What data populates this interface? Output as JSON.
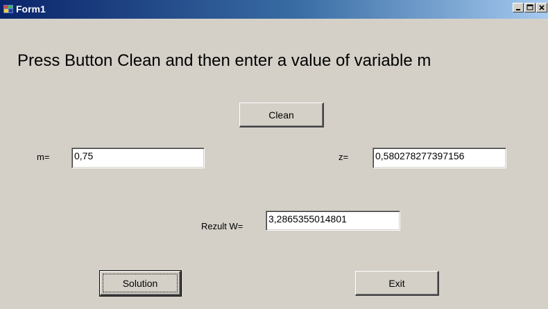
{
  "window": {
    "title": "Form1",
    "controls": [
      "minimize-icon",
      "maximize-icon",
      "close-icon"
    ]
  },
  "main": {
    "heading": "Press Button Clean and then enter a value of variable m",
    "clean_label": "Clean",
    "m_label": "m=",
    "m_value": "0,75",
    "z_label": "z=",
    "z_value": "0,580278277397156",
    "result_label": "Rezult W=",
    "result_value": "3,2865355014801",
    "solution_label": "Solution",
    "exit_label": "Exit"
  }
}
